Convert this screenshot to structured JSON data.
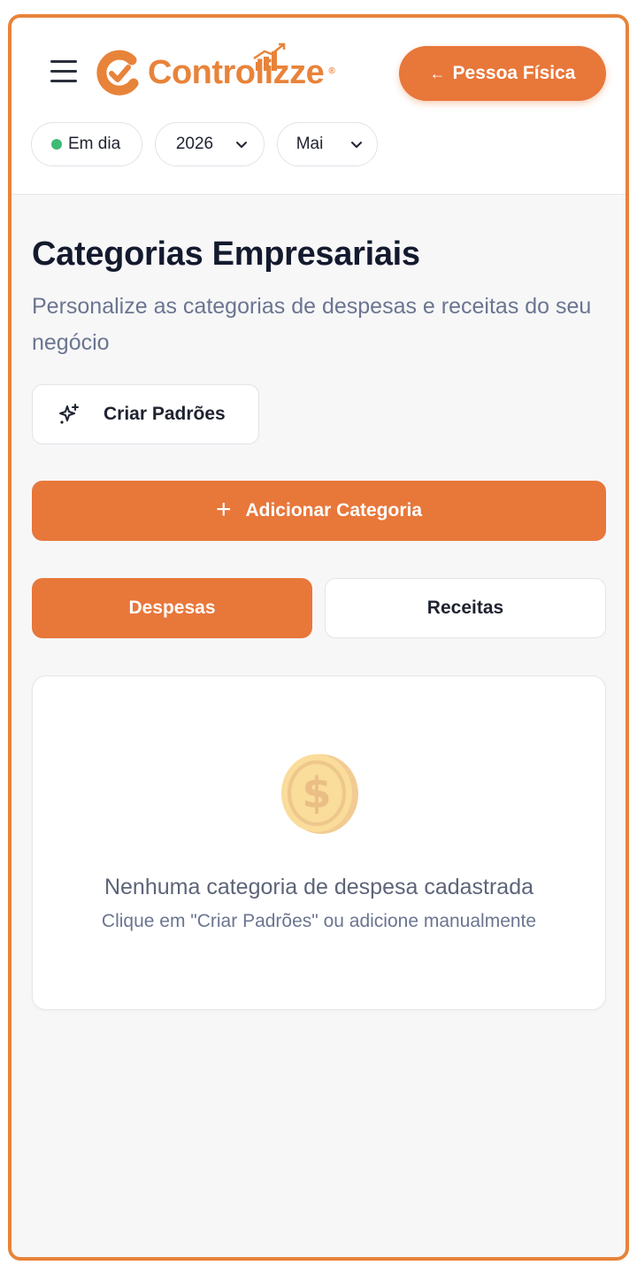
{
  "header": {
    "brand": "Controlizze",
    "brand_mark": "®",
    "switch_button": {
      "arrow": "←",
      "label": "Pessoa Física"
    },
    "status_chip": {
      "label": "Em dia",
      "color": "#3dbb74"
    },
    "year_select": {
      "value": "2026"
    },
    "month_select": {
      "value": "Mai"
    }
  },
  "page": {
    "title": "Categorias Empresariais",
    "subtitle": "Personalize as categorias de despesas e receitas do seu negócio"
  },
  "actions": {
    "create_defaults": "Criar Padrões",
    "add_category_icon": "+",
    "add_category": "Adicionar Categoria"
  },
  "tabs": [
    {
      "label": "Despesas",
      "active": true
    },
    {
      "label": "Receitas",
      "active": false
    }
  ],
  "empty_state": {
    "icon": "coin-dollar-icon",
    "title": "Nenhuma categoria de despesa cadastrada",
    "hint": "Clique em \"Criar Padrões\" ou adicione manualmente"
  },
  "colors": {
    "accent": "#e8773a",
    "frame": "#e8833a",
    "status_green": "#3dbb74"
  }
}
